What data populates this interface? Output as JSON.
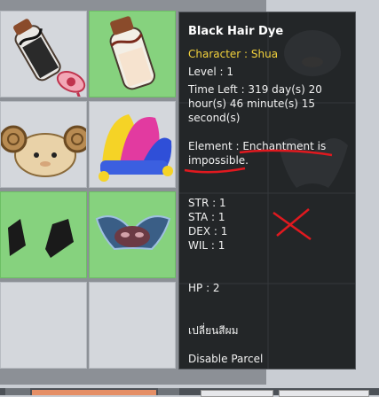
{
  "tooltip": {
    "title": "Black Hair Dye",
    "character": "Character : Shua",
    "level": "Level : 1",
    "time_left_1": "Time Left : 319 day(s) 20",
    "time_left_2": "hour(s) 46 minute(s) 15",
    "time_left_3": "second(s)",
    "element_1": "Element : Enchantment is",
    "element_2": "impossible.",
    "str": "STR : 1",
    "sta": "STA : 1",
    "dex": "DEX : 1",
    "wil": "WIL : 1",
    "hp": "HP : 2",
    "thai_text": "เปลี่ยนสีผม",
    "disable_parcel": "Disable Parcel"
  },
  "inventory": {
    "slots": [
      {
        "item": "dye-bottle-with-fan-icon",
        "highlighted": false
      },
      {
        "item": "dye-bottle-icon",
        "highlighted": true
      },
      {
        "item": "ram-hat-icon",
        "highlighted": false
      },
      {
        "item": "jester-hat-icon",
        "highlighted": false
      },
      {
        "item": "black-boots-icon",
        "highlighted": true
      },
      {
        "item": "winged-mask-icon",
        "highlighted": true
      },
      {
        "item": "empty",
        "highlighted": false
      },
      {
        "item": "empty",
        "highlighted": false
      }
    ]
  },
  "annotations": {
    "color": "#e0191f"
  }
}
